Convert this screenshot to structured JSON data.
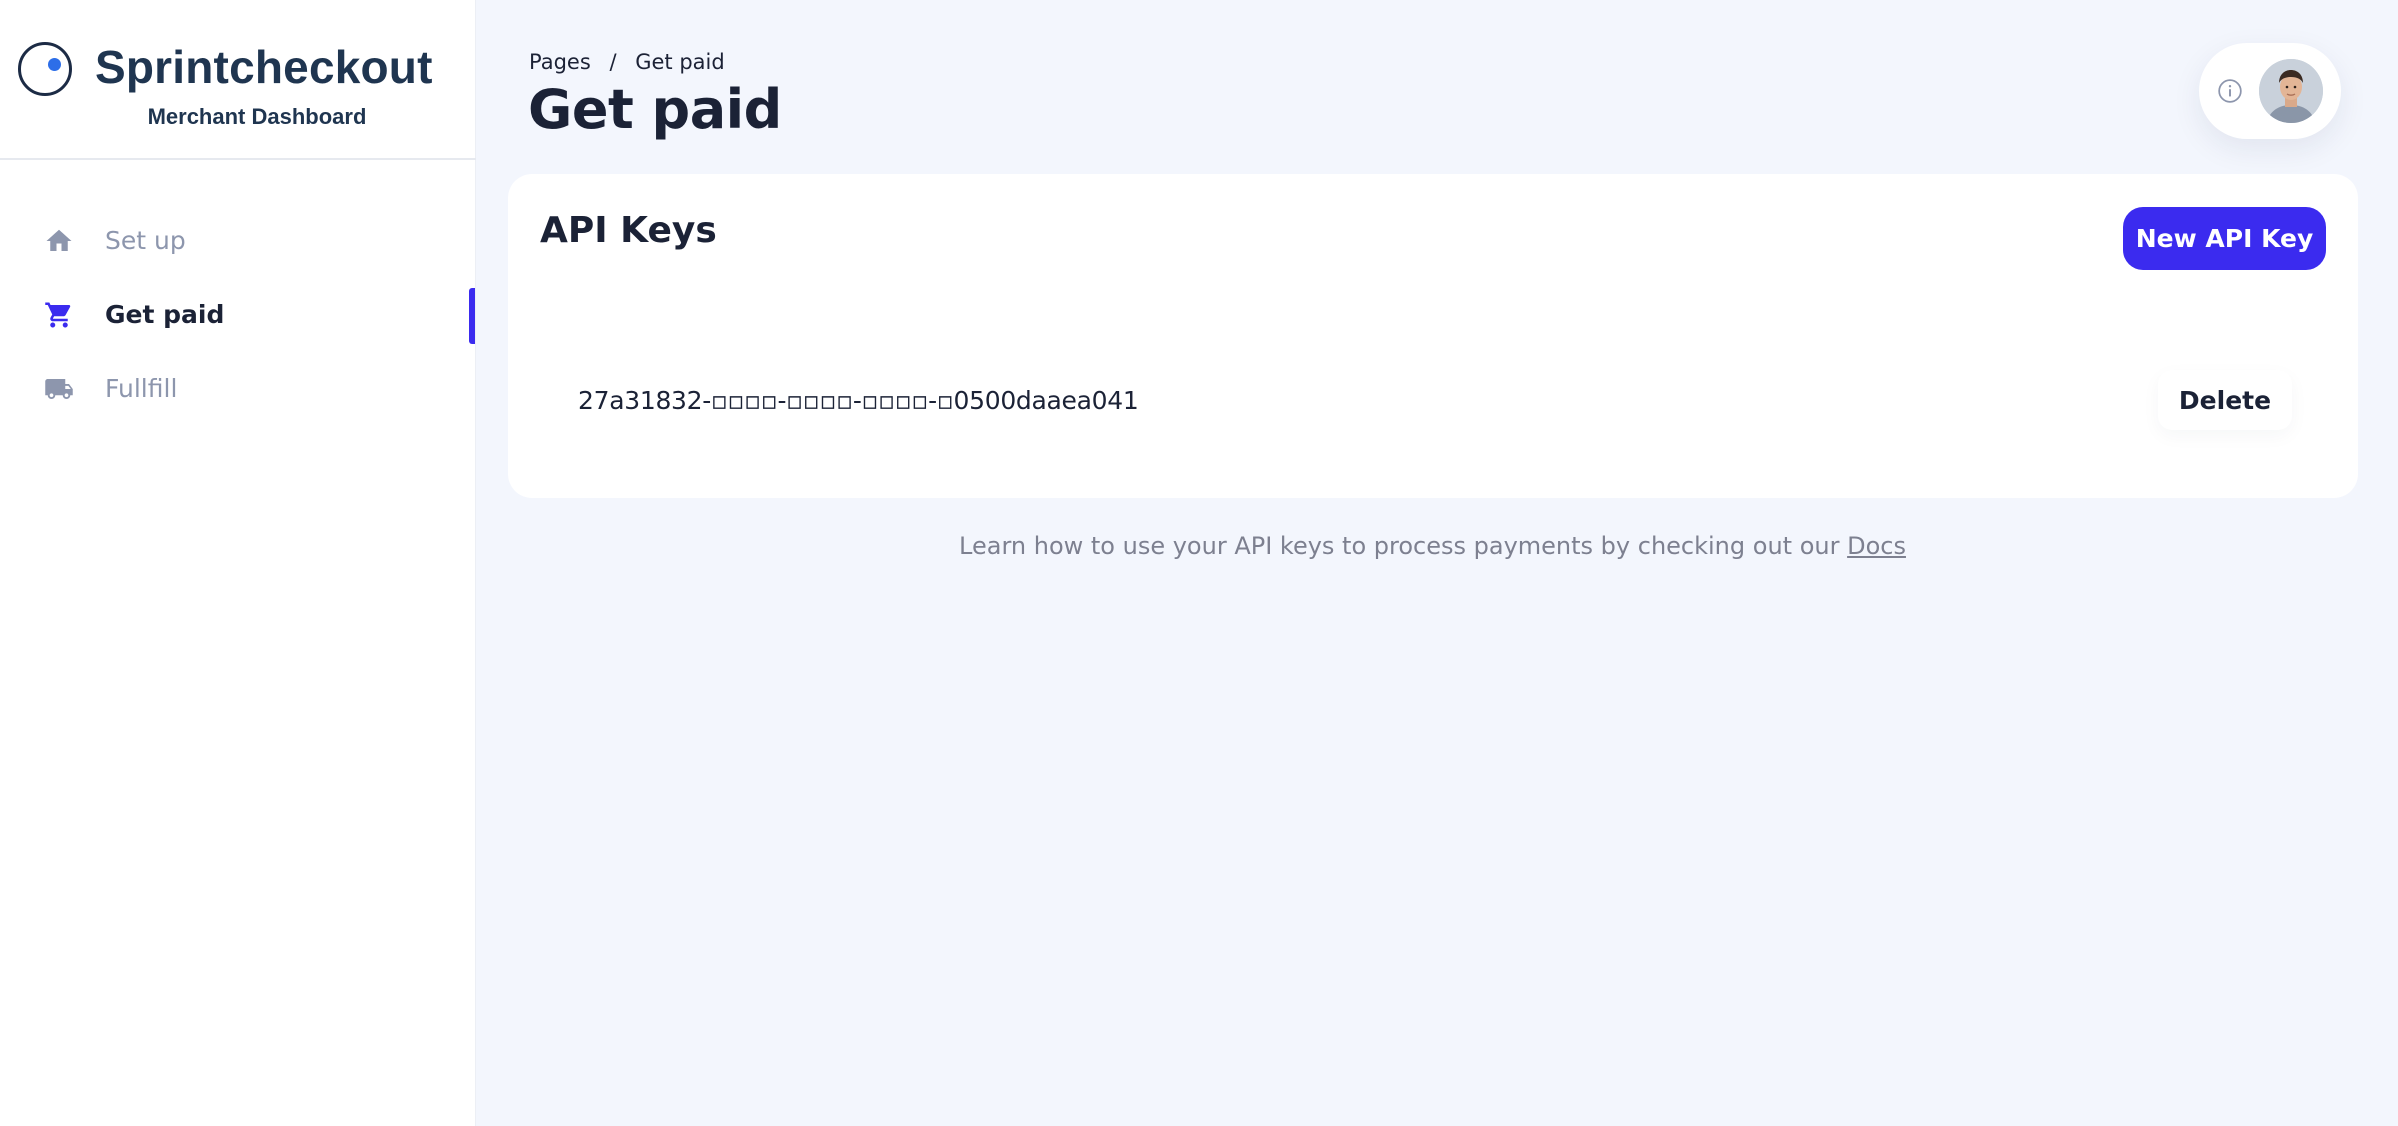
{
  "brand": {
    "title": "Sprintcheckout",
    "subtitle": "Merchant Dashboard"
  },
  "sidebar": {
    "items": [
      {
        "label": "Set up",
        "icon": "home-icon",
        "active": false
      },
      {
        "label": "Get paid",
        "icon": "cart-icon",
        "active": true
      },
      {
        "label": "Fullfill",
        "icon": "truck-icon",
        "active": false
      }
    ]
  },
  "header": {
    "breadcrumb": {
      "root": "Pages",
      "separator": "/",
      "current": "Get paid"
    },
    "title": "Get paid"
  },
  "api_keys": {
    "title": "API Keys",
    "new_button": "New API Key",
    "keys": [
      {
        "value": "27a31832-▫▫▫▫-▫▫▫▫-▫▫▫▫-▫0500daaea041",
        "delete_label": "Delete"
      }
    ]
  },
  "help": {
    "text": "Learn how to use your API keys to process payments by checking out our",
    "link": "Docs"
  },
  "colors": {
    "accent": "#3b2bef",
    "brand_text": "#1f3550",
    "background": "#f3f6fd",
    "muted_nav": "#8d96ad"
  }
}
